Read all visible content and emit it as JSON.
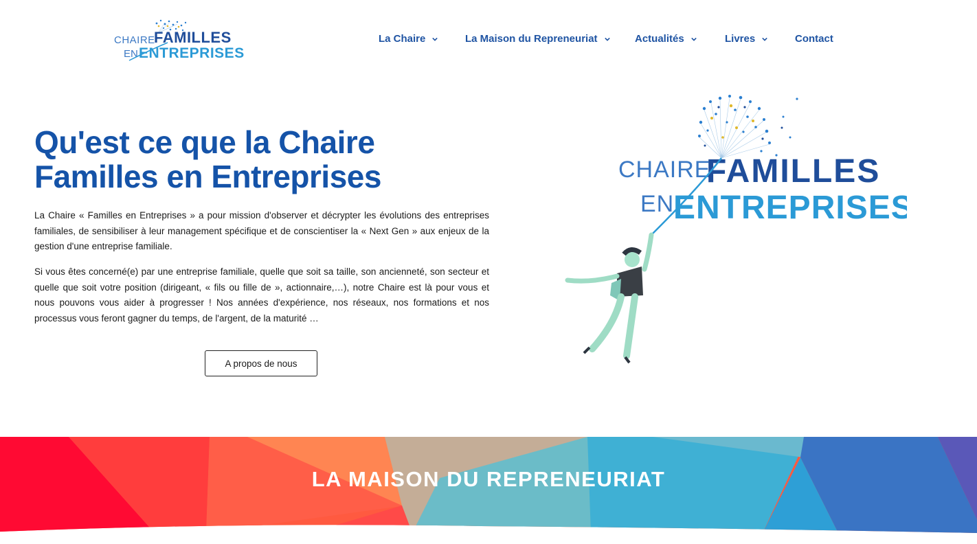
{
  "header": {
    "logo": {
      "line1": "CHAIRE",
      "line2": "FAMILLES",
      "line3": "EN",
      "line4": "ENTREPRISES"
    },
    "nav": [
      {
        "label": "La Chaire",
        "has_dropdown": true,
        "icon": "chevron-down-icon"
      },
      {
        "label": "La Maison du Repreneuriat",
        "has_dropdown": true,
        "icon": "chevron-down-icon"
      },
      {
        "label": "Actualités",
        "has_dropdown": true,
        "icon": "chevron-down-icon"
      },
      {
        "label": "Livres",
        "has_dropdown": true,
        "icon": "chevron-down-icon"
      },
      {
        "label": "Contact",
        "has_dropdown": false
      }
    ]
  },
  "hero": {
    "title": "Qu'est ce que la Chaire Familles en Entreprises",
    "paragraph1": "La Chaire « Familles en Entreprises » a pour mission d'observer et décrypter les évolutions des entreprises familiales, de sensibiliser à leur management spécifique et de conscientiser la « Next Gen » aux enjeux de la gestion d'une entreprise familiale.",
    "paragraph2": "Si vous êtes concerné(e) par une entreprise familiale, quelle que soit sa taille, son ancienneté, son secteur et quelle que soit votre position (dirigeant, « fils ou fille de », actionnaire,…), notre Chaire est là pour vous et nous pouvons vous aider à progresser ! Nos années d'expérience, nos réseaux, nos formations et nos processus vous feront gagner du temps, de l'argent, de la maturité …",
    "button_label": "A propos de nous",
    "illustration": {
      "logo_line1": "CHAIRE",
      "logo_line2": "FAMILLES",
      "logo_line3": "EN",
      "logo_line4": "ENTREPRISES"
    }
  },
  "banner": {
    "title": "LA MAISON DU REPRENEURIAT"
  },
  "colors": {
    "nav_text": "#1f54a3",
    "title": "#1553a8",
    "logo_dark": "#1f4d9a",
    "logo_light": "#2b9ad6"
  }
}
